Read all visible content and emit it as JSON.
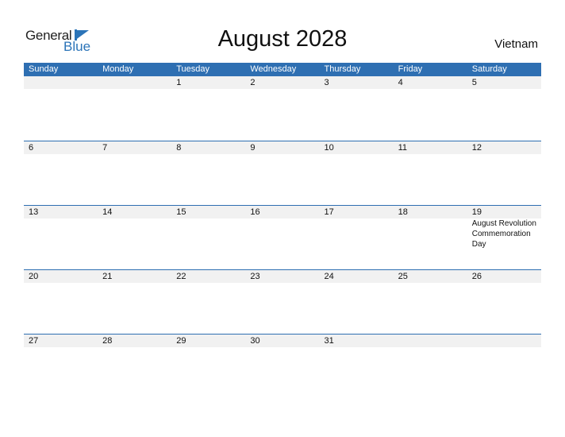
{
  "logo": {
    "text_general": "General",
    "text_blue": "Blue"
  },
  "header": {
    "title": "August 2028",
    "country": "Vietnam"
  },
  "weekdays": [
    "Sunday",
    "Monday",
    "Tuesday",
    "Wednesday",
    "Thursday",
    "Friday",
    "Saturday"
  ],
  "weeks": [
    {
      "days": [
        "",
        "",
        "1",
        "2",
        "3",
        "4",
        "5"
      ],
      "events": [
        "",
        "",
        "",
        "",
        "",
        "",
        ""
      ]
    },
    {
      "days": [
        "6",
        "7",
        "8",
        "9",
        "10",
        "11",
        "12"
      ],
      "events": [
        "",
        "",
        "",
        "",
        "",
        "",
        ""
      ]
    },
    {
      "days": [
        "13",
        "14",
        "15",
        "16",
        "17",
        "18",
        "19"
      ],
      "events": [
        "",
        "",
        "",
        "",
        "",
        "",
        "August Revolution Commemoration Day"
      ]
    },
    {
      "days": [
        "20",
        "21",
        "22",
        "23",
        "24",
        "25",
        "26"
      ],
      "events": [
        "",
        "",
        "",
        "",
        "",
        "",
        ""
      ]
    },
    {
      "days": [
        "27",
        "28",
        "29",
        "30",
        "31",
        "",
        ""
      ],
      "events": [
        "",
        "",
        "",
        "",
        "",
        "",
        ""
      ]
    }
  ],
  "colors": {
    "header_bg": "#2e6fb2",
    "accent": "#2b74b8",
    "date_row_bg": "#f1f1f1"
  }
}
